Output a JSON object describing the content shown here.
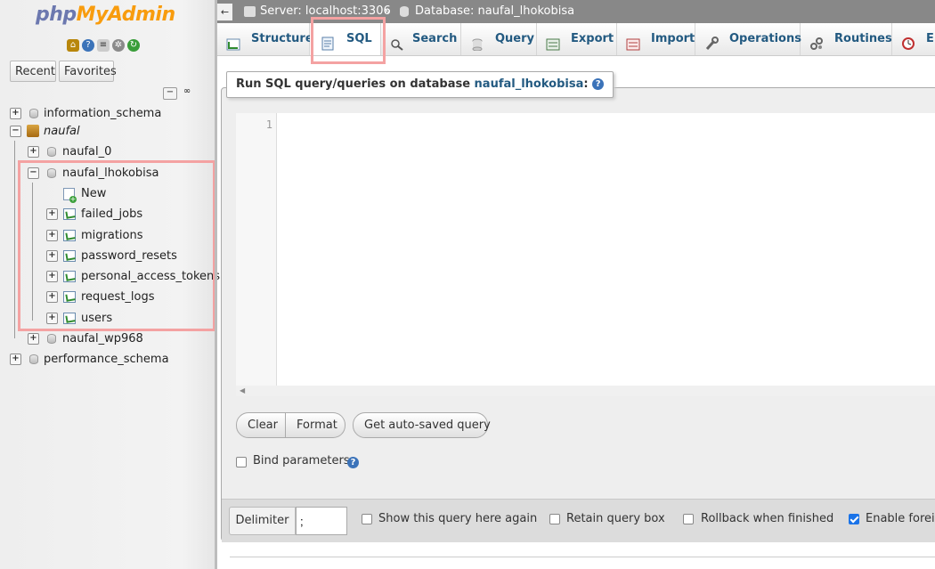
{
  "logo": {
    "part1": "php",
    "part2": "MyAdmin"
  },
  "nav": {
    "recent_label": "Recent",
    "favorites_label": "Favorites",
    "collapse_symbol": "−",
    "link_symbol": "∞",
    "plus": "+",
    "minus": "−",
    "tree": {
      "information_schema": "information_schema",
      "group": "naufal",
      "naufal_0": "naufal_0",
      "naufal_lhokobisa": "naufal_lhokobisa",
      "new": "New",
      "tables": [
        "failed_jobs",
        "migrations",
        "password_resets",
        "personal_access_tokens",
        "request_logs",
        "users"
      ],
      "naufal_wp968": "naufal_wp968",
      "performance_schema": "performance_schema"
    }
  },
  "topbar": {
    "back": "←",
    "server": "Server: localhost:3306",
    "separator": "»",
    "database": "Database: naufal_lhokobisa"
  },
  "tabs": [
    "Structure",
    "SQL",
    "Search",
    "Query",
    "Export",
    "Import",
    "Operations",
    "Routines",
    "E"
  ],
  "active_tab": "SQL",
  "sql_panel": {
    "legend_prefix": "Run SQL query/queries on database ",
    "database_name": "naufal_lhokobisa",
    "legend_suffix": ":",
    "help": "?",
    "line_number": "1",
    "scroll_arrow": "◀",
    "clear_label": "Clear",
    "format_label": "Format",
    "autosave_label": "Get auto-saved query",
    "bind_label": "Bind parameters"
  },
  "bottom": {
    "delimiter_label": "Delimiter",
    "delimiter_value": ";",
    "show_query": {
      "label": "Show this query here again",
      "checked": false
    },
    "retain_box": {
      "label": "Retain query box",
      "checked": false
    },
    "rollback": {
      "label": "Rollback when finished",
      "checked": false
    },
    "foreign": {
      "label": "Enable foreign",
      "checked": true
    }
  },
  "colors": {
    "link": "#235a81",
    "highlight": "#f4a2a2",
    "logo_php": "#6c78af",
    "logo_myadmin": "#f89c0e"
  }
}
